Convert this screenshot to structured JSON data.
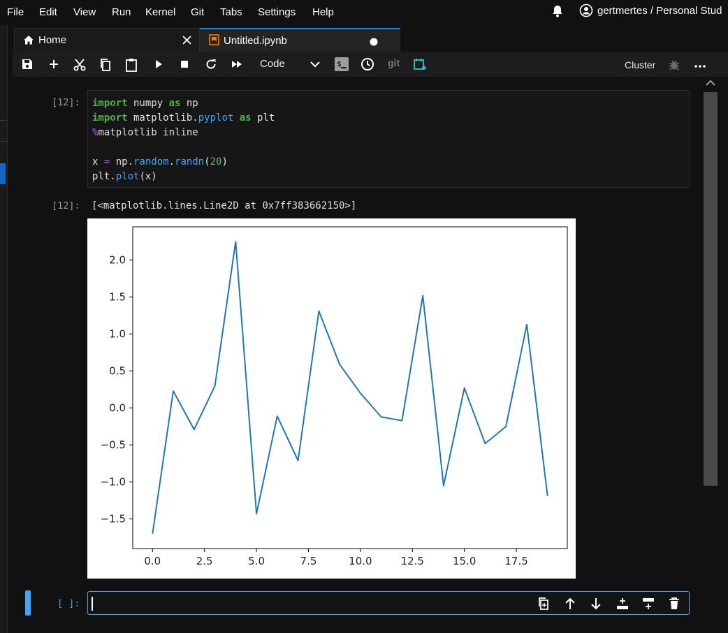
{
  "menubar": {
    "items": [
      "File",
      "Edit",
      "View",
      "Run",
      "Kernel",
      "Git",
      "Tabs",
      "Settings",
      "Help"
    ],
    "user": "gertmertes / Personal Stud"
  },
  "tabs": [
    {
      "label": "Home"
    },
    {
      "label": "Untitled.ipynb"
    }
  ],
  "toolbar": {
    "cell_type": "Code",
    "git_label": "git",
    "cluster_label": "Cluster"
  },
  "cell1": {
    "in_prompt": "[12]:",
    "out_prompt": "[12]:",
    "code_lines": [
      {
        "a": "import",
        "b": " numpy ",
        "c": "as",
        "d": " np"
      },
      {
        "a": "import",
        "b": " matplotlib.",
        "c": "pyplot",
        "d": " as",
        "e": " plt"
      },
      {
        "a": "%",
        "b": "matplotlib inline"
      },
      {
        "a": "x ",
        "b": "=",
        "c": " np.",
        "d": "random",
        "e": ".",
        "f": "randn",
        "g": "(",
        "h": "20",
        "i": ")"
      },
      {
        "a": "plt.",
        "b": "plot",
        "c": "(x)"
      }
    ],
    "output_text": "[<matplotlib.lines.Line2D at 0x7ff383662150>]"
  },
  "cell2": {
    "in_prompt": "[ ]:"
  },
  "colors": {
    "accent": "#42a5f5",
    "line": "#1f77b4",
    "keyword": "#4caf50",
    "magic": "#bb5bff"
  },
  "chart_data": {
    "type": "line",
    "x": [
      0,
      1,
      2,
      3,
      4,
      5,
      6,
      7,
      8,
      9,
      10,
      11,
      12,
      13,
      14,
      15,
      16,
      17,
      18,
      19
    ],
    "series": [
      {
        "values": [
          -1.7,
          0.23,
          -0.29,
          0.3,
          2.25,
          -1.43,
          -0.11,
          -0.71,
          1.31,
          0.59,
          0.2,
          -0.12,
          -0.17,
          1.52,
          -1.05,
          0.27,
          -0.48,
          -0.25,
          1.13,
          -1.19
        ]
      }
    ],
    "xlim": [
      -0.95,
      19.95
    ],
    "ylim": [
      -1.9,
      2.45
    ],
    "xticks": [
      0.0,
      2.5,
      5.0,
      7.5,
      10.0,
      12.5,
      15.0,
      17.5
    ],
    "xtick_labels": [
      "0.0",
      "2.5",
      "5.0",
      "7.5",
      "10.0",
      "12.5",
      "15.0",
      "17.5"
    ],
    "yticks": [
      -1.5,
      -1.0,
      -0.5,
      0.0,
      0.5,
      1.0,
      1.5,
      2.0
    ],
    "ytick_labels": [
      "−1.5",
      "−1.0",
      "−0.5",
      "0.0",
      "0.5",
      "1.0",
      "1.5",
      "2.0"
    ],
    "grid": false
  }
}
